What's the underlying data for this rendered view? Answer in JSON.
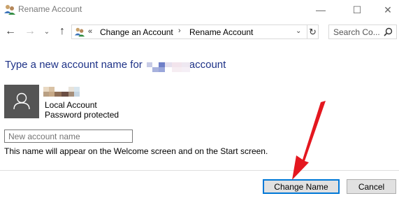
{
  "window": {
    "title": "Rename Account",
    "minimize": "—",
    "maximize": "☐",
    "close": "✕"
  },
  "nav": {
    "back": "←",
    "forward": "→",
    "recent": "⌄",
    "up": "↑",
    "breadcrumb_overflow": "«",
    "breadcrumbs": [
      "Change an Account",
      "Rename Account"
    ],
    "separator": "›",
    "dropdown": "⌄",
    "refresh": "↻",
    "search_placeholder": "Search Co..."
  },
  "main": {
    "heading_prefix": "Type a new account name for",
    "heading_suffix": "account",
    "account_type": "Local Account",
    "account_status": "Password protected",
    "input_placeholder": "New account name",
    "hint": "This name will appear on the Welcome screen and on the Start screen."
  },
  "buttons": {
    "change": "Change Name",
    "cancel": "Cancel"
  },
  "colors": {
    "heading": "#1e3287",
    "accent_focus": "#0078d7",
    "annotation_arrow": "#e4171f",
    "avatar_bg": "#555555"
  },
  "icons": [
    "users-icon",
    "back-arrow-icon",
    "forward-arrow-icon",
    "chevron-down-icon",
    "up-arrow-icon",
    "refresh-icon",
    "search-icon",
    "user-silhouette-icon",
    "annotation-arrow"
  ]
}
